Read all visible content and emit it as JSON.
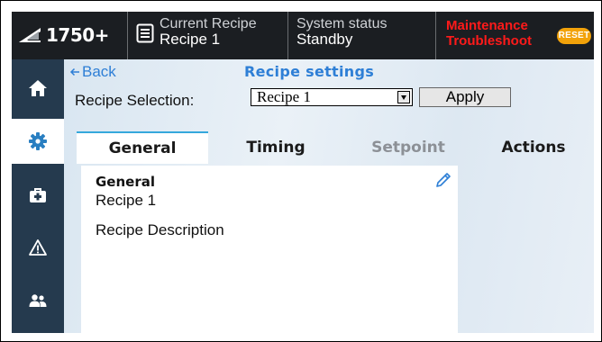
{
  "header": {
    "machine_icon": "machine-icon",
    "machine_label": "1750+",
    "recipe_icon": "document-icon",
    "current_recipe_label": "Current Recipe",
    "current_recipe_value": "Recipe 1",
    "system_status_label": "System status",
    "system_status_value": "Standby",
    "alerts": [
      "Maintenance",
      "Troubleshoot"
    ],
    "alert_color": "#ff1a1a",
    "reset_label": "RESET",
    "reset_color": "#f2a20a"
  },
  "sidebar": {
    "items": [
      {
        "icon": "home-icon",
        "active": false
      },
      {
        "icon": "gear-icon",
        "active": true
      },
      {
        "icon": "medkit-icon",
        "active": false
      },
      {
        "icon": "warning-icon",
        "active": false
      },
      {
        "icon": "users-icon",
        "active": false
      }
    ]
  },
  "main": {
    "back_label": "Back",
    "page_title": "Recipe settings",
    "selection_label": "Recipe Selection:",
    "selection_value": "Recipe 1",
    "apply_label": "Apply",
    "tabs": [
      {
        "label": "General",
        "active": true,
        "enabled": true
      },
      {
        "label": "Timing",
        "active": false,
        "enabled": true
      },
      {
        "label": "Setpoint",
        "active": false,
        "enabled": false
      },
      {
        "label": "Actions",
        "active": false,
        "enabled": true
      }
    ],
    "panel": {
      "heading": "General",
      "recipe_name": "Recipe 1",
      "description": "Recipe Description",
      "edit_icon": "pencil-icon"
    }
  },
  "colors": {
    "accent": "#2e7fd6",
    "tab_highlight": "#35a8dc",
    "topbar_bg": "#1b1e22",
    "sidebar_bg": "#253a4e"
  }
}
